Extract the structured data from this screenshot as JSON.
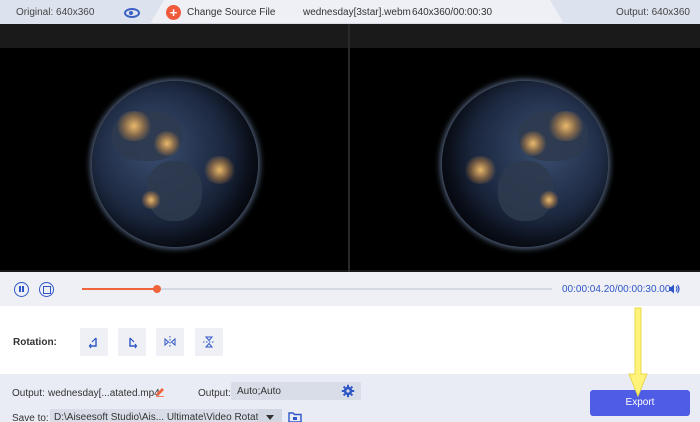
{
  "topbar": {
    "original_label": "Original: 640x360",
    "change_source_label": "Change Source File",
    "filename": "wednesday[3star].webm",
    "file_info": "640x360/00:00:30",
    "output_label": "Output: 640x360"
  },
  "player": {
    "progress_fraction": 0.16,
    "timecode": "00:00:04.20/00:00:30.00"
  },
  "rotation": {
    "label": "Rotation:",
    "buttons": [
      {
        "icon": "rotate-left-icon"
      },
      {
        "icon": "rotate-right-icon"
      },
      {
        "icon": "flip-horizontal-icon"
      },
      {
        "icon": "flip-vertical-icon"
      }
    ]
  },
  "output": {
    "output_name_label": "Output:",
    "output_name_value": "wednesday[...atated.mp4",
    "output_format_label": "Output:",
    "output_format_value": "Auto;Auto",
    "save_to_label": "Save to:",
    "save_to_value": "D:\\Aiseesoft Studio\\Ais... Ultimate\\Video Rotator"
  },
  "export": {
    "label": "Export"
  },
  "colors": {
    "accent": "#2f56c7",
    "progress": "#f0643c",
    "export": "#4e5ce6",
    "annotation": "#fff37a"
  }
}
